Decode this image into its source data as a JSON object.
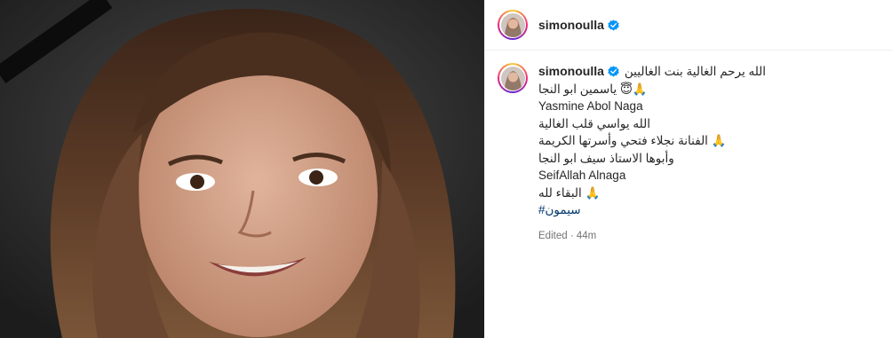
{
  "post": {
    "username": "simonoulla",
    "caption": {
      "first_line_text": "الله يرحم الغالية بنت الغاليين",
      "lines": [
        "ياسمين ابو النجا 😇🙏",
        "Yasmine Abol Naga",
        "الله يواسي قلب الغالية",
        "الفنانة نجلاء فتحي وأسرتها الكريمة 🙏",
        "وأبوها الاستاذ سيف ابو النجا",
        "SeifAllah Alnaga",
        "البقاء لله 🙏"
      ],
      "hashtag": "#سيمون"
    },
    "edited_label": "Edited",
    "time_ago": "44m",
    "colors": {
      "verified": "#0095f6",
      "hashtag": "#00376b",
      "meta": "#737373"
    }
  }
}
